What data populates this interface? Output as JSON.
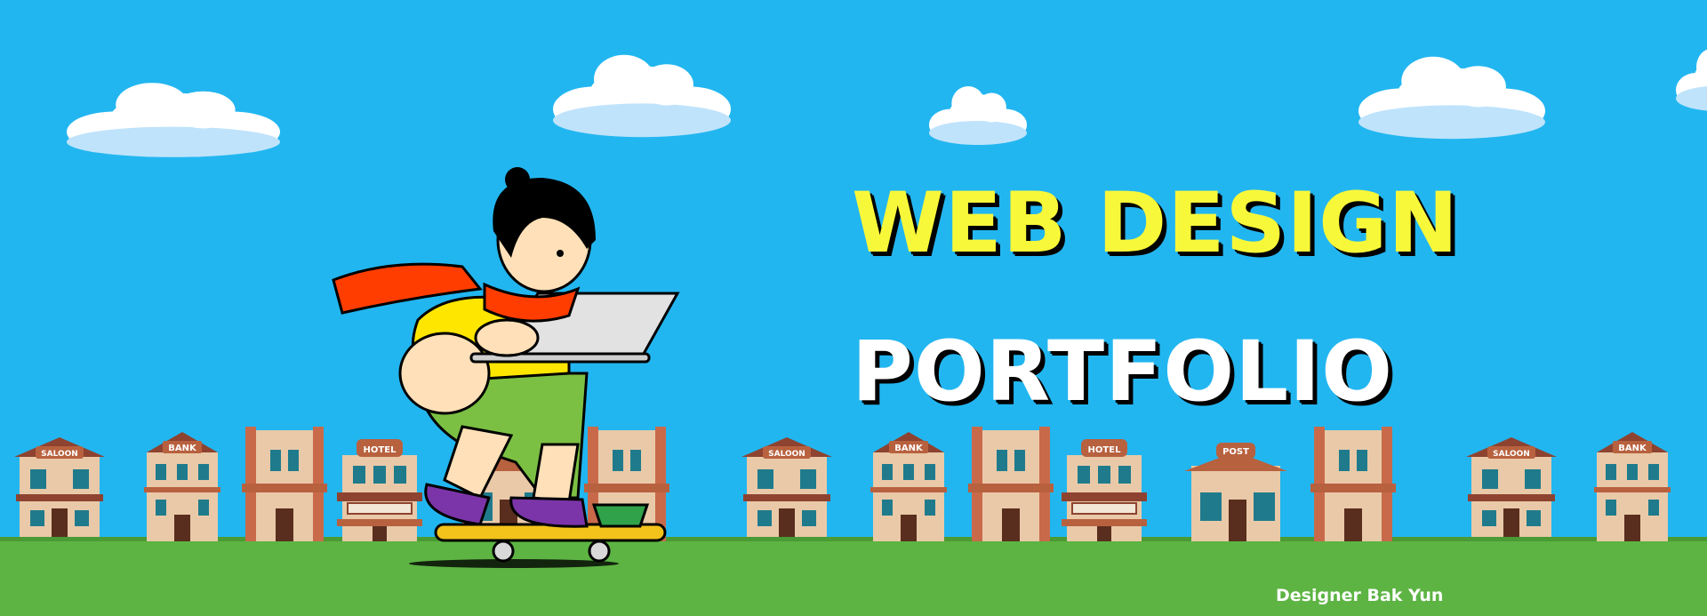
{
  "hero": {
    "title_line_1": "WEB DESIGN",
    "title_line_2": "PORTFOLIO",
    "credit": "Designer Bak Yun"
  },
  "buildings": {
    "saloon_sign": "SALOON",
    "bank_sign": "BANK",
    "hotel_sign": "HOTEL",
    "post_sign": "POST"
  },
  "colors": {
    "sky": "#22b6f0",
    "grass": "#5db443",
    "title_primary": "#f8f83a",
    "title_secondary": "#ffffff",
    "scarf": "#ff3d00",
    "shirt": "#ffe600",
    "pants": "#7bc043",
    "shoes": "#7b35a8"
  },
  "illustration": {
    "character": "girl-on-skateboard-with-laptop",
    "background": "western-town-buildings",
    "clouds": 5
  }
}
